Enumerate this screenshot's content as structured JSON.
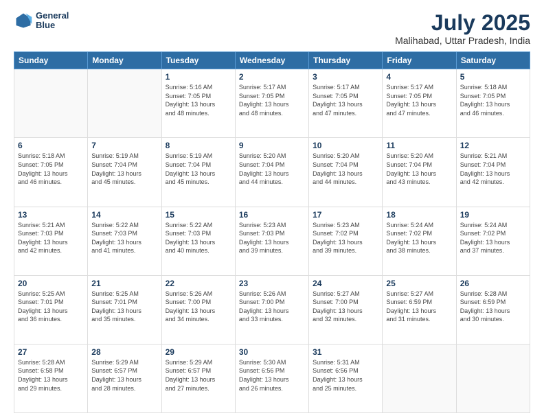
{
  "header": {
    "logo_line1": "General",
    "logo_line2": "Blue",
    "month": "July 2025",
    "location": "Malihabad, Uttar Pradesh, India"
  },
  "weekdays": [
    "Sunday",
    "Monday",
    "Tuesday",
    "Wednesday",
    "Thursday",
    "Friday",
    "Saturday"
  ],
  "weeks": [
    [
      {
        "day": "",
        "info": ""
      },
      {
        "day": "",
        "info": ""
      },
      {
        "day": "1",
        "info": "Sunrise: 5:16 AM\nSunset: 7:05 PM\nDaylight: 13 hours\nand 48 minutes."
      },
      {
        "day": "2",
        "info": "Sunrise: 5:17 AM\nSunset: 7:05 PM\nDaylight: 13 hours\nand 48 minutes."
      },
      {
        "day": "3",
        "info": "Sunrise: 5:17 AM\nSunset: 7:05 PM\nDaylight: 13 hours\nand 47 minutes."
      },
      {
        "day": "4",
        "info": "Sunrise: 5:17 AM\nSunset: 7:05 PM\nDaylight: 13 hours\nand 47 minutes."
      },
      {
        "day": "5",
        "info": "Sunrise: 5:18 AM\nSunset: 7:05 PM\nDaylight: 13 hours\nand 46 minutes."
      }
    ],
    [
      {
        "day": "6",
        "info": "Sunrise: 5:18 AM\nSunset: 7:05 PM\nDaylight: 13 hours\nand 46 minutes."
      },
      {
        "day": "7",
        "info": "Sunrise: 5:19 AM\nSunset: 7:04 PM\nDaylight: 13 hours\nand 45 minutes."
      },
      {
        "day": "8",
        "info": "Sunrise: 5:19 AM\nSunset: 7:04 PM\nDaylight: 13 hours\nand 45 minutes."
      },
      {
        "day": "9",
        "info": "Sunrise: 5:20 AM\nSunset: 7:04 PM\nDaylight: 13 hours\nand 44 minutes."
      },
      {
        "day": "10",
        "info": "Sunrise: 5:20 AM\nSunset: 7:04 PM\nDaylight: 13 hours\nand 44 minutes."
      },
      {
        "day": "11",
        "info": "Sunrise: 5:20 AM\nSunset: 7:04 PM\nDaylight: 13 hours\nand 43 minutes."
      },
      {
        "day": "12",
        "info": "Sunrise: 5:21 AM\nSunset: 7:04 PM\nDaylight: 13 hours\nand 42 minutes."
      }
    ],
    [
      {
        "day": "13",
        "info": "Sunrise: 5:21 AM\nSunset: 7:03 PM\nDaylight: 13 hours\nand 42 minutes."
      },
      {
        "day": "14",
        "info": "Sunrise: 5:22 AM\nSunset: 7:03 PM\nDaylight: 13 hours\nand 41 minutes."
      },
      {
        "day": "15",
        "info": "Sunrise: 5:22 AM\nSunset: 7:03 PM\nDaylight: 13 hours\nand 40 minutes."
      },
      {
        "day": "16",
        "info": "Sunrise: 5:23 AM\nSunset: 7:03 PM\nDaylight: 13 hours\nand 39 minutes."
      },
      {
        "day": "17",
        "info": "Sunrise: 5:23 AM\nSunset: 7:02 PM\nDaylight: 13 hours\nand 39 minutes."
      },
      {
        "day": "18",
        "info": "Sunrise: 5:24 AM\nSunset: 7:02 PM\nDaylight: 13 hours\nand 38 minutes."
      },
      {
        "day": "19",
        "info": "Sunrise: 5:24 AM\nSunset: 7:02 PM\nDaylight: 13 hours\nand 37 minutes."
      }
    ],
    [
      {
        "day": "20",
        "info": "Sunrise: 5:25 AM\nSunset: 7:01 PM\nDaylight: 13 hours\nand 36 minutes."
      },
      {
        "day": "21",
        "info": "Sunrise: 5:25 AM\nSunset: 7:01 PM\nDaylight: 13 hours\nand 35 minutes."
      },
      {
        "day": "22",
        "info": "Sunrise: 5:26 AM\nSunset: 7:00 PM\nDaylight: 13 hours\nand 34 minutes."
      },
      {
        "day": "23",
        "info": "Sunrise: 5:26 AM\nSunset: 7:00 PM\nDaylight: 13 hours\nand 33 minutes."
      },
      {
        "day": "24",
        "info": "Sunrise: 5:27 AM\nSunset: 7:00 PM\nDaylight: 13 hours\nand 32 minutes."
      },
      {
        "day": "25",
        "info": "Sunrise: 5:27 AM\nSunset: 6:59 PM\nDaylight: 13 hours\nand 31 minutes."
      },
      {
        "day": "26",
        "info": "Sunrise: 5:28 AM\nSunset: 6:59 PM\nDaylight: 13 hours\nand 30 minutes."
      }
    ],
    [
      {
        "day": "27",
        "info": "Sunrise: 5:28 AM\nSunset: 6:58 PM\nDaylight: 13 hours\nand 29 minutes."
      },
      {
        "day": "28",
        "info": "Sunrise: 5:29 AM\nSunset: 6:57 PM\nDaylight: 13 hours\nand 28 minutes."
      },
      {
        "day": "29",
        "info": "Sunrise: 5:29 AM\nSunset: 6:57 PM\nDaylight: 13 hours\nand 27 minutes."
      },
      {
        "day": "30",
        "info": "Sunrise: 5:30 AM\nSunset: 6:56 PM\nDaylight: 13 hours\nand 26 minutes."
      },
      {
        "day": "31",
        "info": "Sunrise: 5:31 AM\nSunset: 6:56 PM\nDaylight: 13 hours\nand 25 minutes."
      },
      {
        "day": "",
        "info": ""
      },
      {
        "day": "",
        "info": ""
      }
    ]
  ]
}
